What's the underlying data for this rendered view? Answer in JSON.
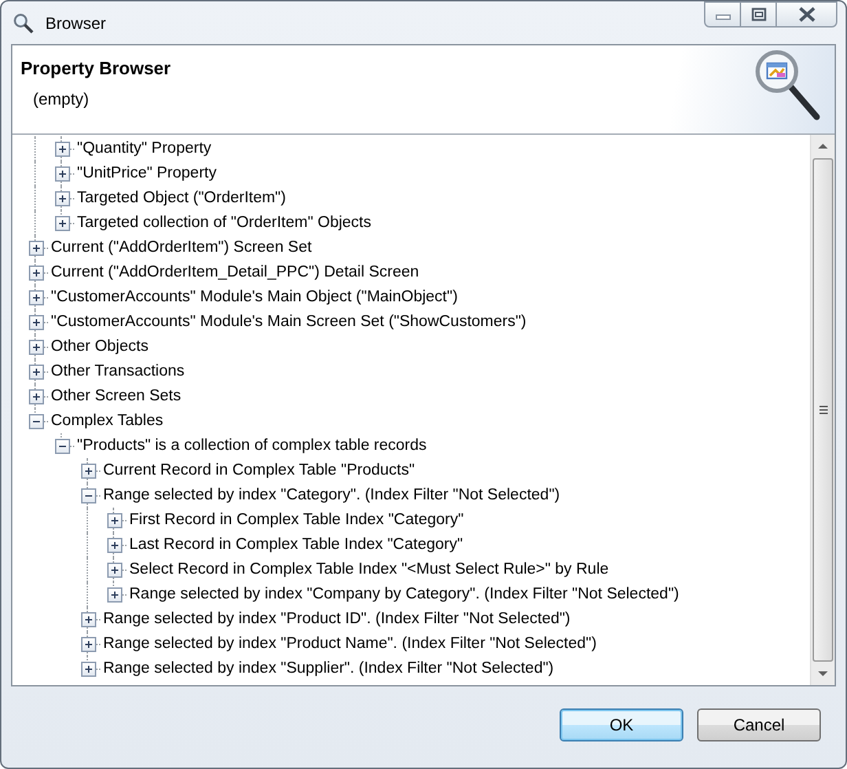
{
  "window": {
    "title": "Browser"
  },
  "header": {
    "title": "Property Browser",
    "subtitle": "(empty)"
  },
  "tree": [
    {
      "kind": "continued",
      "children": [
        {
          "label": "\"Quantity\" Property",
          "expanded": false
        },
        {
          "label": "\"UnitPrice\" Property",
          "expanded": false
        },
        {
          "label": "Targeted Object (\"OrderItem\")",
          "expanded": false
        },
        {
          "label": "Targeted collection of \"OrderItem\" Objects",
          "expanded": false
        }
      ]
    },
    {
      "label": "Current (\"AddOrderItem\") Screen Set",
      "expanded": false
    },
    {
      "label": "Current (\"AddOrderItem_Detail_PPC\") Detail Screen",
      "expanded": false
    },
    {
      "label": "\"CustomerAccounts\" Module's Main Object (\"MainObject\")",
      "expanded": false
    },
    {
      "label": "\"CustomerAccounts\" Module's Main Screen Set (\"ShowCustomers\")",
      "expanded": false
    },
    {
      "label": "Other Objects",
      "expanded": false
    },
    {
      "label": "Other Transactions",
      "expanded": false
    },
    {
      "label": "Other Screen Sets",
      "expanded": false
    },
    {
      "label": "Complex Tables",
      "expanded": true,
      "children": [
        {
          "label": "\"Products\" is a collection of complex table records",
          "expanded": true,
          "children": [
            {
              "label": "Current Record in Complex Table \"Products\"",
              "expanded": false
            },
            {
              "label": "Range selected by index \"Category\". (Index Filter \"Not Selected\")",
              "expanded": true,
              "children": [
                {
                  "label": "First Record in Complex Table Index \"Category\"",
                  "expanded": false
                },
                {
                  "label": "Last Record in Complex Table Index \"Category\"",
                  "expanded": false
                },
                {
                  "label": "Select Record in Complex Table Index \"<Must Select Rule>\" by Rule",
                  "expanded": false
                },
                {
                  "label": "Range selected by index \"Company by Category\". (Index Filter \"Not Selected\")",
                  "expanded": false
                }
              ]
            },
            {
              "label": "Range selected by index \"Product ID\". (Index Filter \"Not Selected\")",
              "expanded": false
            },
            {
              "label": "Range selected by index \"Product Name\". (Index Filter \"Not Selected\")",
              "expanded": false
            },
            {
              "label": "Range selected by index \"Supplier\". (Index Filter \"Not Selected\")",
              "expanded": false
            }
          ]
        }
      ]
    }
  ],
  "buttons": [
    {
      "label": "OK",
      "kind": "default"
    },
    {
      "label": "Cancel",
      "kind": "normal"
    }
  ]
}
